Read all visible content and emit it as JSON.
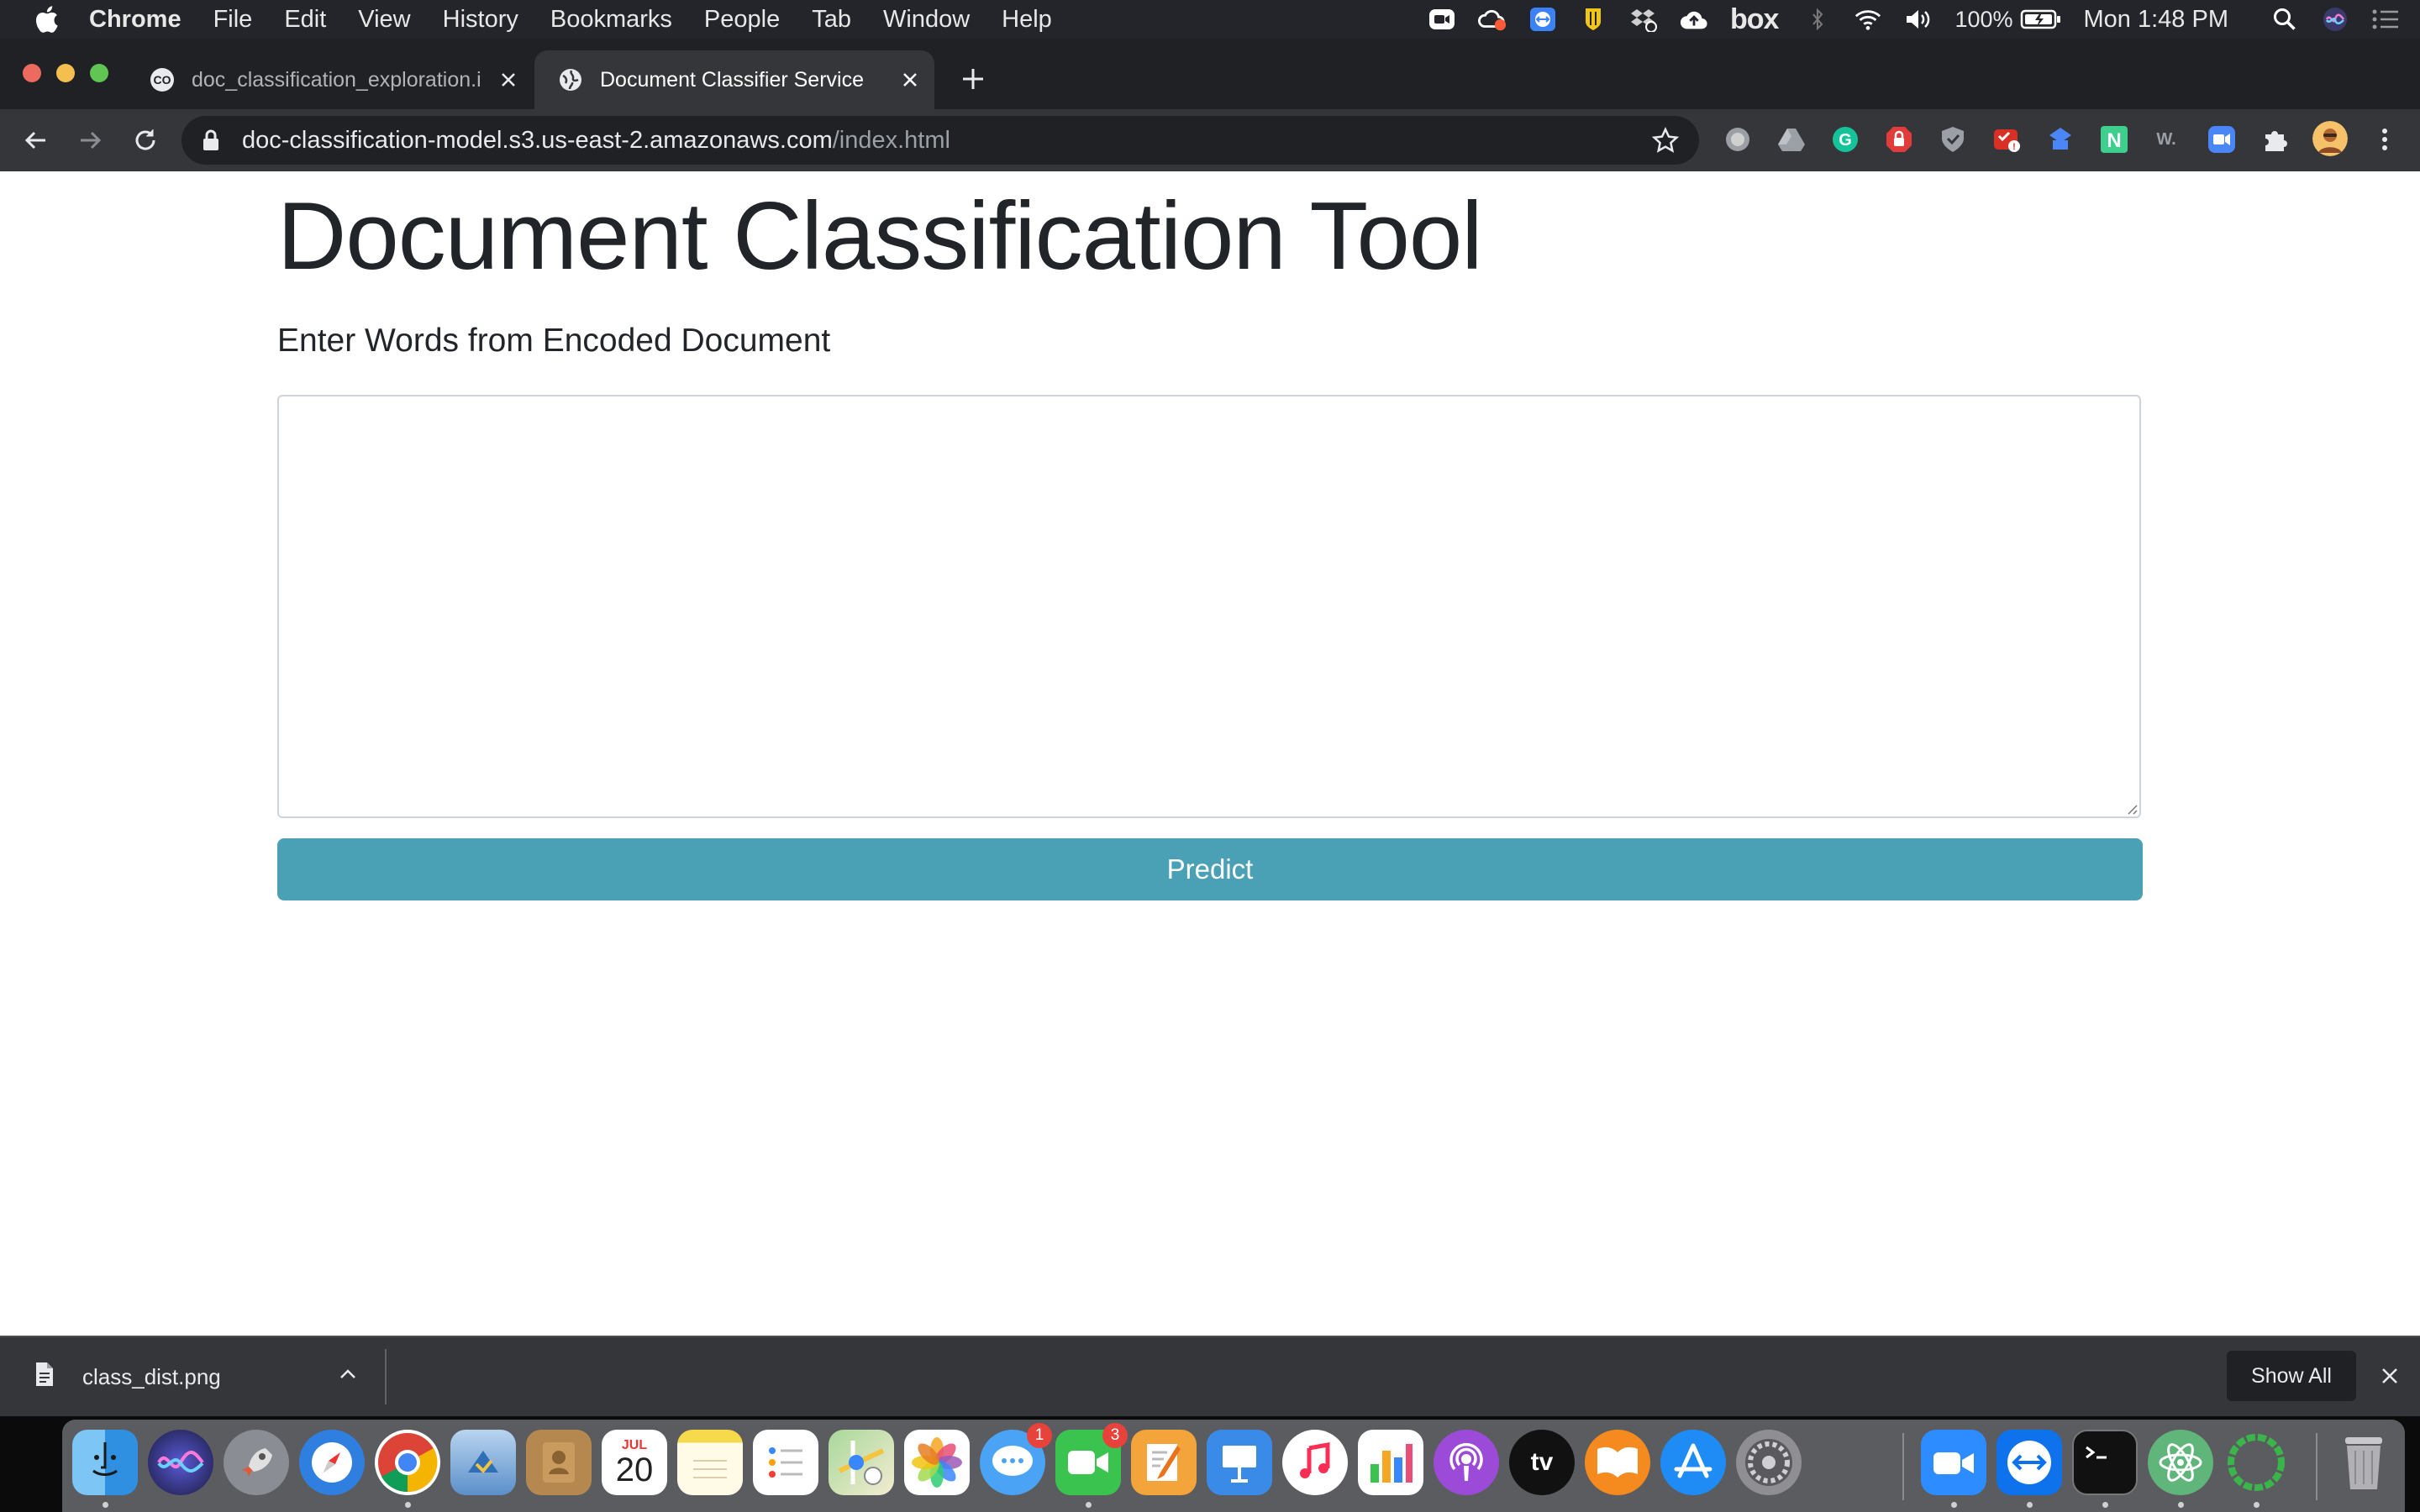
{
  "menubar": {
    "app_name": "Chrome",
    "items": [
      "File",
      "Edit",
      "View",
      "History",
      "Bookmarks",
      "People",
      "Tab",
      "Window",
      "Help"
    ],
    "box_label": "box",
    "battery": "100%",
    "clock": "Mon 1:48 PM"
  },
  "tabs": [
    {
      "title": "doc_classification_exploration.i",
      "favicon": "colab-icon",
      "active": false
    },
    {
      "title": "Document Classifier Service",
      "favicon": "globe-icon",
      "active": true
    }
  ],
  "toolbar": {
    "url_host": "doc-classification-model.s3.us-east-2.amazonaws.com",
    "url_path": "/index.html",
    "extensions": [
      "circle-ext-icon",
      "drive-icon",
      "grammarly-icon",
      "adblock-icon",
      "shield-icon",
      "todo-ext-icon",
      "bookmark-ext-icon",
      "notion-n-icon",
      "w-ext-icon",
      "zoom-ext-icon",
      "puzzle-icon",
      "profile-avatar"
    ]
  },
  "page": {
    "heading": "Document Classification Tool",
    "subheading": "Enter Words from Encoded Document",
    "textarea_value": "",
    "predict_label": "Predict"
  },
  "download_shelf": {
    "file_name": "class_dist.png",
    "show_all_label": "Show All"
  },
  "dock": {
    "apps": [
      "finder",
      "siri",
      "launchpad",
      "safari",
      "chrome",
      "mail",
      "contacts",
      "calendar",
      "notes",
      "reminders",
      "maps",
      "photos",
      "messages",
      "facetime",
      "pages",
      "keynote",
      "music",
      "numbers",
      "podcasts",
      "tv",
      "books",
      "app-store",
      "system-preferences",
      "zoom",
      "teamviewer",
      "terminal",
      "atom",
      "circle-app",
      "trash"
    ],
    "calendar_month": "JUL",
    "calendar_day": "20",
    "messages_badge": "1",
    "facetime_badge": "3",
    "tv_label": "tv"
  },
  "colors": {
    "menubar_bg": "#24252a",
    "tabstrip_bg": "#202124",
    "toolbar_bg": "#35363a",
    "predict_button": "#4aa0b5",
    "heading_text": "#212529"
  }
}
